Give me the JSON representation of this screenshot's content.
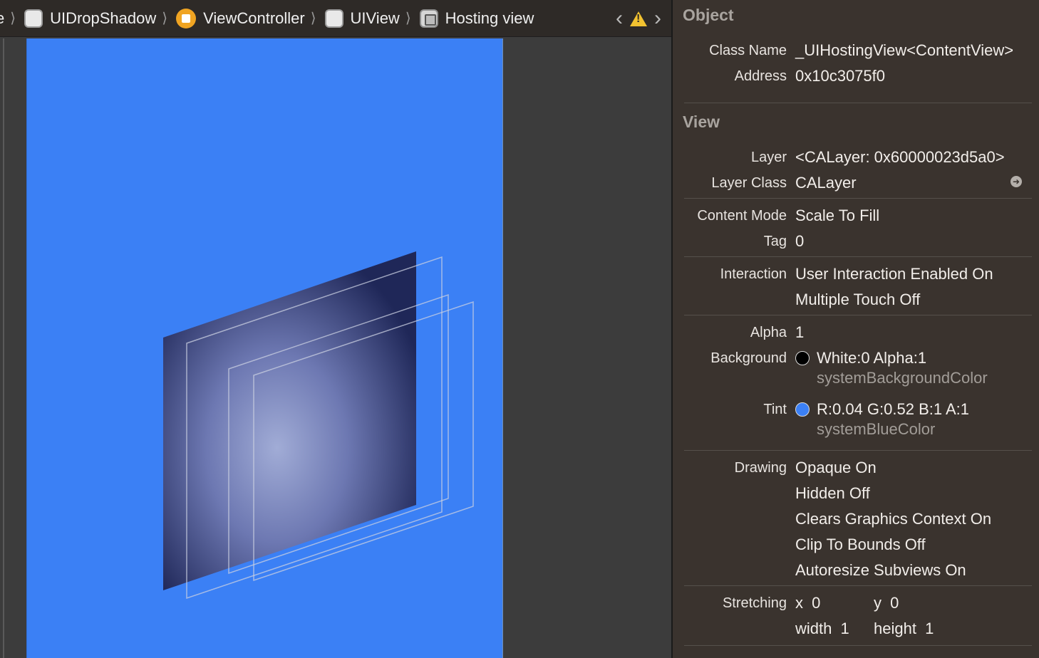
{
  "jumpbar": {
    "crumbs": [
      {
        "label": "e"
      },
      {
        "label": "UIDropShadow"
      },
      {
        "label": "ViewController"
      },
      {
        "label": "UIView"
      },
      {
        "label": "Hosting view"
      }
    ]
  },
  "inspector": {
    "object": {
      "title": "Object",
      "class_name_label": "Class Name",
      "class_name_value": "_UIHostingView<ContentView>",
      "address_label": "Address",
      "address_value": "0x10c3075f0"
    },
    "view": {
      "title": "View",
      "layer_label": "Layer",
      "layer_value": "<CALayer: 0x60000023d5a0>",
      "layer_class_label": "Layer Class",
      "layer_class_value": "CALayer",
      "content_mode_label": "Content Mode",
      "content_mode_value": "Scale To Fill",
      "tag_label": "Tag",
      "tag_value": "0",
      "interaction_label": "Interaction",
      "interaction_values": [
        "User Interaction Enabled On",
        "Multiple Touch Off"
      ],
      "alpha_label": "Alpha",
      "alpha_value": "1",
      "background_label": "Background",
      "background_value": "White:0 Alpha:1",
      "background_name": "systemBackgroundColor",
      "background_color": "#000000",
      "tint_label": "Tint",
      "tint_value": "R:0.04 G:0.52 B:1 A:1",
      "tint_name": "systemBlueColor",
      "tint_color": "#3b80f5",
      "drawing_label": "Drawing",
      "drawing_values": [
        "Opaque On",
        "Hidden Off",
        "Clears Graphics Context On",
        "Clip To Bounds Off",
        "Autoresize Subviews On"
      ],
      "stretching_label": "Stretching",
      "stretch_x_label": "x",
      "stretch_x_value": "0",
      "stretch_y_label": "y",
      "stretch_y_value": "0",
      "stretch_w_label": "width",
      "stretch_w_value": "1",
      "stretch_h_label": "height",
      "stretch_h_value": "1"
    }
  },
  "colors": {
    "canvas_blue": "#3b80f5",
    "panel_bg": "#3a332e",
    "jumpbar_bg": "#2e2a27",
    "vc_icon": "#f0a422",
    "warning": "#f2c230"
  }
}
